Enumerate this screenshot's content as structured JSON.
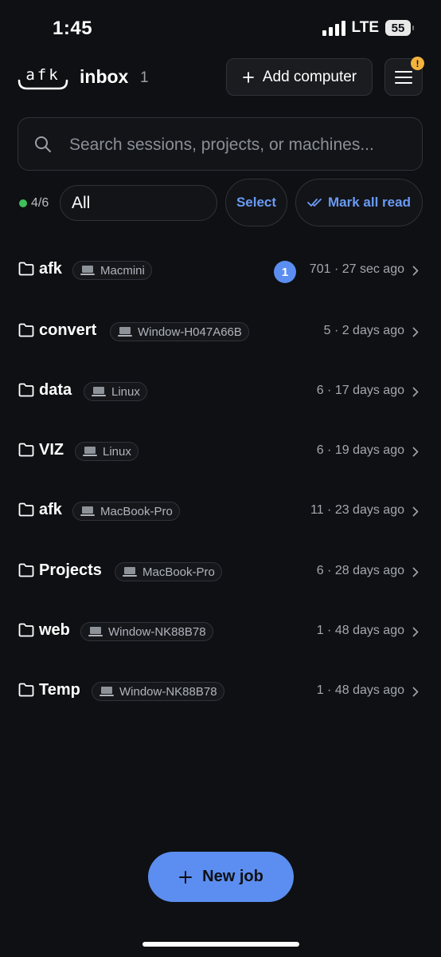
{
  "status_bar": {
    "time": "1:45",
    "network": "LTE",
    "battery": "55"
  },
  "header": {
    "logo_text": "afk",
    "title": "inbox",
    "count": "1",
    "add_computer_label": "Add computer",
    "menu_badge": "!"
  },
  "search": {
    "placeholder": "Search sessions, projects, or machines..."
  },
  "filters": {
    "online_count": "4/6",
    "selected_filter": "All",
    "select_label": "Select",
    "mark_all_read_label": "Mark all read"
  },
  "sessions": [
    {
      "name": "afk",
      "machine": "Macmini",
      "unread": "1",
      "meta": "701 · 27 sec ago"
    },
    {
      "name": "convert",
      "machine": "Window-H047A66B",
      "meta": "5 · 2 days ago"
    },
    {
      "name": "data",
      "machine": "Linux",
      "meta": "6 · 17 days ago"
    },
    {
      "name": "VIZ",
      "machine": "Linux",
      "meta": "6 · 19 days ago"
    },
    {
      "name": "afk",
      "machine": "MacBook-Pro",
      "meta": "11 · 23 days ago"
    },
    {
      "name": "Projects",
      "machine": "MacBook-Pro",
      "meta": "6 · 28 days ago"
    },
    {
      "name": "web",
      "machine": "Window-NK88B78",
      "meta": "1 · 48 days ago"
    },
    {
      "name": "Temp",
      "machine": "Window-NK88B78",
      "meta": "1 · 48 days ago"
    }
  ],
  "fab": {
    "new_job_label": "New job"
  },
  "colors": {
    "background": "#0f1013",
    "accent": "#5b8ef0",
    "online": "#3ec05b",
    "warning": "#f3b33d"
  },
  "icons": [
    "signal-icon",
    "battery-icon",
    "afk-logo",
    "plus-icon",
    "menu-icon",
    "search-icon",
    "double-check-icon",
    "folder-icon",
    "laptop-icon",
    "chevron-right-icon"
  ]
}
